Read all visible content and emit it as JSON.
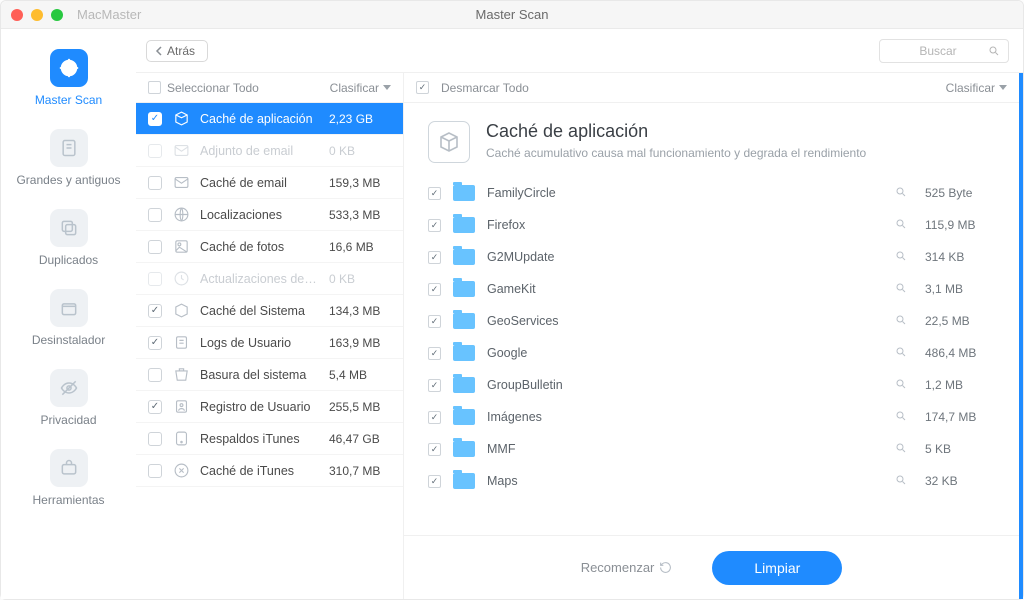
{
  "app": {
    "name": "MacMaster",
    "window_title": "Master Scan"
  },
  "toolbar": {
    "back": "Atrás",
    "search_placeholder": "Buscar"
  },
  "sidebar": {
    "items": [
      {
        "label": "Master Scan"
      },
      {
        "label": "Grandes y antiguos"
      },
      {
        "label": "Duplicados"
      },
      {
        "label": "Desinstalador"
      },
      {
        "label": "Privacidad"
      },
      {
        "label": "Herramientas"
      }
    ]
  },
  "left_pane": {
    "select_all": "Seleccionar Todo",
    "sort": "Clasificar",
    "categories": [
      {
        "name": "Caché de aplicación",
        "size": "2,23 GB",
        "checked": true,
        "selected": true,
        "disabled": false
      },
      {
        "name": "Adjunto de email",
        "size": "0 KB",
        "checked": false,
        "selected": false,
        "disabled": true
      },
      {
        "name": "Caché de email",
        "size": "159,3 MB",
        "checked": false,
        "selected": false,
        "disabled": false
      },
      {
        "name": "Localizaciones",
        "size": "533,3 MB",
        "checked": false,
        "selected": false,
        "disabled": false
      },
      {
        "name": "Caché de fotos",
        "size": "16,6 MB",
        "checked": false,
        "selected": false,
        "disabled": false
      },
      {
        "name": "Actualizaciones de so",
        "size": "0 KB",
        "checked": false,
        "selected": false,
        "disabled": true
      },
      {
        "name": "Caché del Sistema",
        "size": "134,3 MB",
        "checked": true,
        "selected": false,
        "disabled": false
      },
      {
        "name": "Logs de Usuario",
        "size": "163,9 MB",
        "checked": true,
        "selected": false,
        "disabled": false
      },
      {
        "name": "Basura del sistema",
        "size": "5,4 MB",
        "checked": false,
        "selected": false,
        "disabled": false
      },
      {
        "name": "Registro de Usuario",
        "size": "255,5 MB",
        "checked": true,
        "selected": false,
        "disabled": false
      },
      {
        "name": "Respaldos iTunes",
        "size": "46,47 GB",
        "checked": false,
        "selected": false,
        "disabled": false
      },
      {
        "name": "Caché de iTunes",
        "size": "310,7 MB",
        "checked": false,
        "selected": false,
        "disabled": false
      }
    ]
  },
  "right_pane": {
    "deselect_all": "Desmarcar Todo",
    "sort": "Clasificar",
    "title": "Caché de aplicación",
    "subtitle": "Caché acumulativo causa mal funcionamiento y degrada el rendimiento",
    "files": [
      {
        "name": "FamilyCircle",
        "size": "525 Byte"
      },
      {
        "name": "Firefox",
        "size": "115,9 MB"
      },
      {
        "name": "G2MUpdate",
        "size": "314 KB"
      },
      {
        "name": "GameKit",
        "size": "3,1 MB"
      },
      {
        "name": "GeoServices",
        "size": "22,5 MB"
      },
      {
        "name": "Google",
        "size": "486,4 MB"
      },
      {
        "name": "GroupBulletin",
        "size": "1,2 MB"
      },
      {
        "name": "Imágenes",
        "size": "174,7 MB"
      },
      {
        "name": "MMF",
        "size": "5 KB"
      },
      {
        "name": "Maps",
        "size": "32 KB"
      }
    ]
  },
  "footer": {
    "restart": "Recomenzar",
    "clean": "Limpiar"
  }
}
